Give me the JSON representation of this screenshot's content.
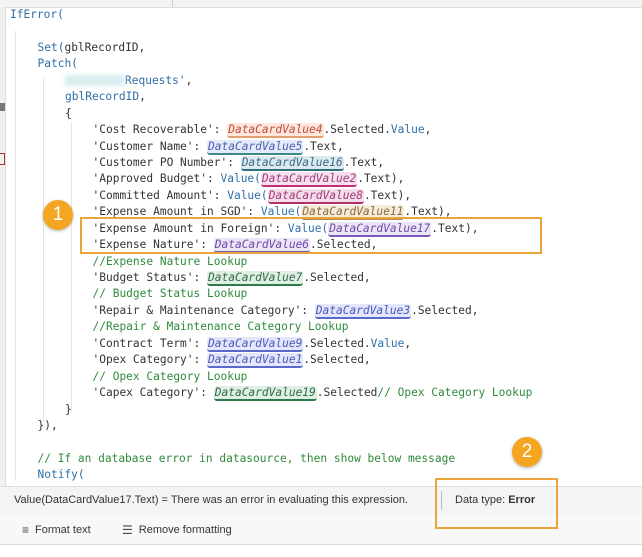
{
  "code": {
    "lines": [
      {
        "indent": 0,
        "parts": [
          [
            "kw",
            "IfError("
          ]
        ]
      },
      {
        "indent": 0,
        "parts": []
      },
      {
        "indent": 1,
        "parts": [
          [
            "kw",
            "Set("
          ],
          [
            "str",
            "gblRecordID,"
          ]
        ]
      },
      {
        "indent": 1,
        "parts": [
          [
            "kw",
            "Patch("
          ]
        ]
      },
      {
        "indent": 2,
        "parts": [
          [
            "blur",
            ""
          ],
          [
            "kw",
            "Requests'"
          ],
          [
            "str",
            ","
          ]
        ]
      },
      {
        "indent": 2,
        "parts": [
          [
            "kw",
            "gblRecordID"
          ],
          [
            "str",
            ","
          ]
        ]
      },
      {
        "indent": 2,
        "parts": [
          [
            "str",
            "{"
          ]
        ]
      },
      {
        "indent": 3,
        "parts": [
          [
            "str",
            "'Cost Recoverable': "
          ],
          [
            "dcv c-orange",
            "DataCardValue4"
          ],
          [
            "str",
            ".Selected."
          ],
          [
            "kw",
            "Value"
          ],
          [
            "str",
            ","
          ]
        ]
      },
      {
        "indent": 3,
        "parts": [
          [
            "str",
            "'Customer Name': "
          ],
          [
            "dcv c-blue",
            "DataCardValue5"
          ],
          [
            "str",
            ".Text,"
          ]
        ]
      },
      {
        "indent": 3,
        "parts": [
          [
            "str",
            "'Customer PO Number': "
          ],
          [
            "dcv c-teal",
            "DataCardValue16"
          ],
          [
            "str",
            ".Text,"
          ]
        ]
      },
      {
        "indent": 3,
        "parts": [
          [
            "str",
            "'Approved Budget': "
          ],
          [
            "kw",
            "Value("
          ],
          [
            "dcv c-pink",
            "DataCardValue2"
          ],
          [
            "str",
            ".Text),"
          ]
        ]
      },
      {
        "indent": 3,
        "parts": [
          [
            "str",
            "'Committed Amount': "
          ],
          [
            "kw",
            "Value("
          ],
          [
            "dcv c-mag",
            "DataCardValue8"
          ],
          [
            "str",
            ".Text),"
          ]
        ]
      },
      {
        "indent": 3,
        "parts": [
          [
            "str",
            "'Expense Amount in SGD': "
          ],
          [
            "kw",
            "Value("
          ],
          [
            "dcv c-brown",
            "DataCardValue11"
          ],
          [
            "str",
            ".Text),"
          ]
        ]
      },
      {
        "indent": 3,
        "parts": [
          [
            "str",
            "'Expense Amount in Foreign': "
          ],
          [
            "kw",
            "Value("
          ],
          [
            "dcv c-purple",
            "DataCardValue17"
          ],
          [
            "str",
            ".Text),"
          ]
        ]
      },
      {
        "indent": 3,
        "parts": [
          [
            "str",
            "'Expense Nature': "
          ],
          [
            "dcv c-purple",
            "DataCardValue6"
          ],
          [
            "str",
            ".Selected,"
          ]
        ]
      },
      {
        "indent": 3,
        "parts": [
          [
            "cm",
            "//Expense Nature Lookup"
          ]
        ]
      },
      {
        "indent": 3,
        "parts": [
          [
            "str",
            "'Budget Status': "
          ],
          [
            "dcv c-green",
            "DataCardValue7"
          ],
          [
            "str",
            ".Selected,"
          ]
        ]
      },
      {
        "indent": 3,
        "parts": [
          [
            "cm",
            "// Budget Status Lookup"
          ]
        ]
      },
      {
        "indent": 3,
        "parts": [
          [
            "str",
            "'Repair & Maintenance Category': "
          ],
          [
            "dcv c-lav",
            "DataCardValue3"
          ],
          [
            "str",
            ".Selected,"
          ]
        ]
      },
      {
        "indent": 3,
        "parts": [
          [
            "cm",
            "//Repair & Maintenance Category Lookup"
          ]
        ]
      },
      {
        "indent": 3,
        "parts": [
          [
            "str",
            "'Contract Term': "
          ],
          [
            "dcv c-lav",
            "DataCardValue9"
          ],
          [
            "str",
            ".Selected."
          ],
          [
            "kw",
            "Value"
          ],
          [
            "str",
            ","
          ]
        ]
      },
      {
        "indent": 3,
        "parts": [
          [
            "str",
            "'Opex Category': "
          ],
          [
            "dcv c-lav",
            "DataCardValue1"
          ],
          [
            "str",
            ".Selected,"
          ]
        ]
      },
      {
        "indent": 3,
        "parts": [
          [
            "cm",
            "// Opex Category Lookup"
          ]
        ]
      },
      {
        "indent": 3,
        "parts": [
          [
            "str",
            "'Capex Category': "
          ],
          [
            "dcv c-green",
            "DataCardValue19"
          ],
          [
            "str",
            ".Selected"
          ],
          [
            "cm",
            "// Opex Category Lookup"
          ]
        ]
      },
      {
        "indent": 2,
        "parts": [
          [
            "str",
            "}"
          ]
        ]
      },
      {
        "indent": 1,
        "parts": [
          [
            "str",
            "}),"
          ]
        ]
      },
      {
        "indent": 0,
        "parts": []
      },
      {
        "indent": 1,
        "parts": [
          [
            "cm",
            "// If an database error in datasource, then show below message"
          ]
        ]
      },
      {
        "indent": 1,
        "parts": [
          [
            "kw",
            "Notify("
          ]
        ]
      }
    ]
  },
  "error_bar": {
    "expression": "Value(DataCardValue17.Text)  =  There was an error in evaluating this expression.",
    "data_type_label": "Data type: ",
    "data_type_value": "Error"
  },
  "toolbar": {
    "format_text": "Format text",
    "remove_formatting": "Remove formatting",
    "format_icon": "format-text-icon",
    "remove_icon": "remove-formatting-icon"
  },
  "annotations": {
    "badge1": "1",
    "badge2": "2",
    "color": "#f4a623"
  }
}
